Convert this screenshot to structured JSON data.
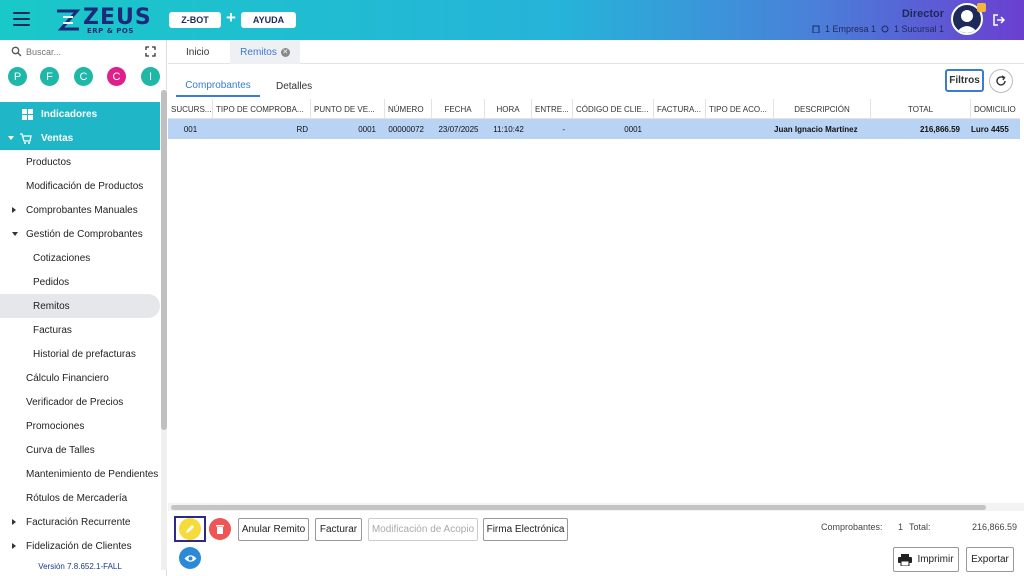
{
  "header": {
    "logo_text": "ZEUS",
    "logo_sub": "ERP & POS",
    "zbot_label": "Z-BOT",
    "plus": "+",
    "ayuda_label": "AYUDA",
    "user_name": "Director",
    "empresa": "1 Empresa 1",
    "sucursal": "1 Sucursal 1"
  },
  "sidebar": {
    "search_placeholder": "Buscar...",
    "quick_access": [
      {
        "letter": "P",
        "color": "#1fb7a8"
      },
      {
        "letter": "F",
        "color": "#1fb7a8"
      },
      {
        "letter": "C",
        "color": "#1fb7a8"
      },
      {
        "letter": "C",
        "color": "#e0208a"
      },
      {
        "letter": "I",
        "color": "#1fb7a8"
      }
    ],
    "items": [
      {
        "label": "Indicadores"
      },
      {
        "label": "Ventas"
      },
      {
        "label": "Productos"
      },
      {
        "label": "Modificación de Productos"
      },
      {
        "label": "Comprobantes Manuales"
      },
      {
        "label": "Gestión de Comprobantes"
      },
      {
        "label": "Cotizaciones"
      },
      {
        "label": "Pedidos"
      },
      {
        "label": "Remitos"
      },
      {
        "label": "Facturas"
      },
      {
        "label": "Historial de prefacturas"
      },
      {
        "label": "Cálculo Financiero"
      },
      {
        "label": "Verificador de Precios"
      },
      {
        "label": "Promociones"
      },
      {
        "label": "Curva de Talles"
      },
      {
        "label": "Mantenimiento de Pendientes"
      },
      {
        "label": "Rótulos de Mercadería"
      },
      {
        "label": "Facturación Recurrente"
      },
      {
        "label": "Fidelización de Clientes"
      }
    ],
    "version": "Versión 7.8.652.1-FALL"
  },
  "tabs": {
    "inicio": "Inicio",
    "remitos": "Remitos"
  },
  "subtabs": {
    "comprobantes": "Comprobantes",
    "detalles": "Detalles"
  },
  "toolbar": {
    "filtros": "Filtros"
  },
  "grid": {
    "headers": [
      "SUCURS...",
      "TIPO DE COMPROBA...",
      "PUNTO DE VE...",
      "NÚMERO",
      "FECHA",
      "HORA",
      "ENTRE...",
      "CÓDIGO DE CLIE...",
      "FACTURA...",
      "TIPO DE ACO...",
      "DESCRIPCIÓN",
      "TOTAL",
      "DOMICILIO"
    ],
    "rows": [
      [
        "001",
        "RD",
        "0001",
        "00000072",
        "23/07/2025",
        "11:10:42",
        "-",
        "0001",
        "",
        "",
        "Juan Ignacio Martínez",
        "216,866.59",
        "Luro 4455"
      ]
    ]
  },
  "actions": {
    "anular": "Anular Remito",
    "facturar": "Facturar",
    "modificacion": "Modificación de Acopio",
    "firma": "Firma Electrónica",
    "imprimir": "Imprimir",
    "exportar": "Exportar"
  },
  "summary": {
    "comprobantes_label": "Comprobantes:",
    "comprobantes_count": "1",
    "total_label": "Total:",
    "total_value": "216,866.59"
  }
}
